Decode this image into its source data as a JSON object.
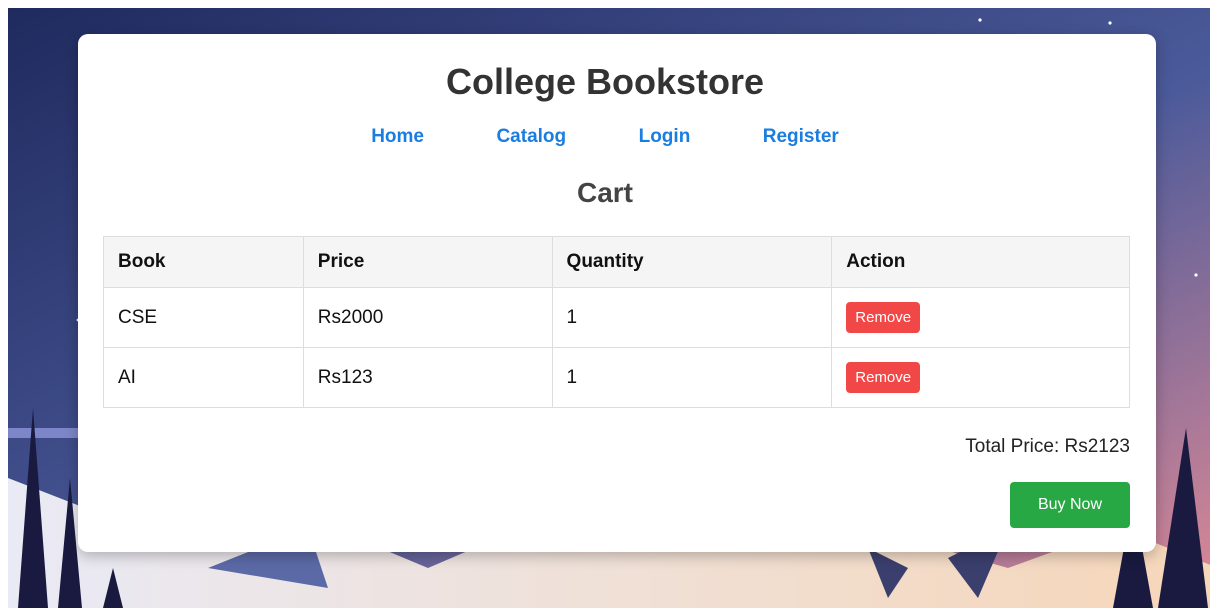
{
  "header": {
    "title": "College Bookstore"
  },
  "nav": {
    "items": [
      "Home",
      "Catalog",
      "Login",
      "Register"
    ]
  },
  "cart": {
    "heading": "Cart",
    "columns": [
      "Book",
      "Price",
      "Quantity",
      "Action"
    ],
    "rows": [
      {
        "book": "CSE",
        "price": "Rs2000",
        "quantity": "1",
        "action": "Remove"
      },
      {
        "book": "AI",
        "price": "Rs123",
        "quantity": "1",
        "action": "Remove"
      }
    ],
    "total_label": "Total Price: Rs2123",
    "buy_label": "Buy Now"
  },
  "colors": {
    "link": "#1a7de0",
    "remove": "#f24747",
    "buy": "#28a745",
    "sky_top": "#1f2a5e",
    "sky_bottom": "#d98a9a"
  }
}
